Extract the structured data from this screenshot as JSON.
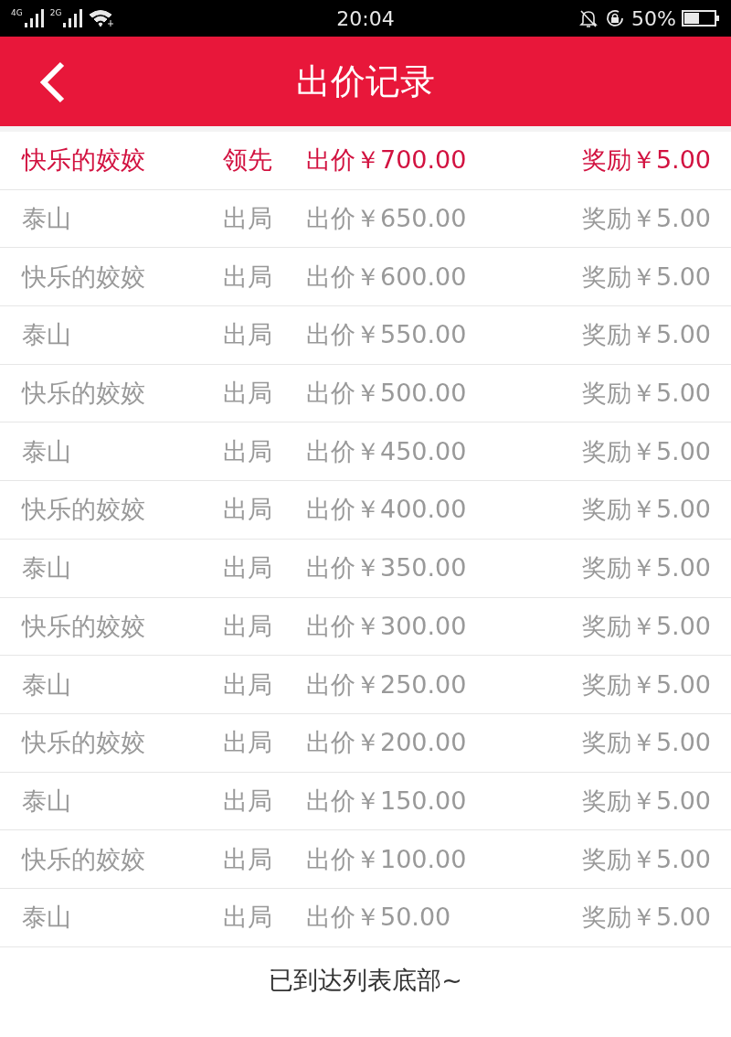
{
  "status_bar": {
    "networks": [
      "4G",
      "2G"
    ],
    "time": "20:04",
    "battery": "50%"
  },
  "header": {
    "title": "出价记录"
  },
  "rows": [
    {
      "name": "快乐的姣姣",
      "status": "领先",
      "bid": "出价￥700.00",
      "reward": "奖励￥5.00",
      "leading": true
    },
    {
      "name": "泰山",
      "status": "出局",
      "bid": "出价￥650.00",
      "reward": "奖励￥5.00",
      "leading": false
    },
    {
      "name": "快乐的姣姣",
      "status": "出局",
      "bid": "出价￥600.00",
      "reward": "奖励￥5.00",
      "leading": false
    },
    {
      "name": "泰山",
      "status": "出局",
      "bid": "出价￥550.00",
      "reward": "奖励￥5.00",
      "leading": false
    },
    {
      "name": "快乐的姣姣",
      "status": "出局",
      "bid": "出价￥500.00",
      "reward": "奖励￥5.00",
      "leading": false
    },
    {
      "name": "泰山",
      "status": "出局",
      "bid": "出价￥450.00",
      "reward": "奖励￥5.00",
      "leading": false
    },
    {
      "name": "快乐的姣姣",
      "status": "出局",
      "bid": "出价￥400.00",
      "reward": "奖励￥5.00",
      "leading": false
    },
    {
      "name": "泰山",
      "status": "出局",
      "bid": "出价￥350.00",
      "reward": "奖励￥5.00",
      "leading": false
    },
    {
      "name": "快乐的姣姣",
      "status": "出局",
      "bid": "出价￥300.00",
      "reward": "奖励￥5.00",
      "leading": false
    },
    {
      "name": "泰山",
      "status": "出局",
      "bid": "出价￥250.00",
      "reward": "奖励￥5.00",
      "leading": false
    },
    {
      "name": "快乐的姣姣",
      "status": "出局",
      "bid": "出价￥200.00",
      "reward": "奖励￥5.00",
      "leading": false
    },
    {
      "name": "泰山",
      "status": "出局",
      "bid": "出价￥150.00",
      "reward": "奖励￥5.00",
      "leading": false
    },
    {
      "name": "快乐的姣姣",
      "status": "出局",
      "bid": "出价￥100.00",
      "reward": "奖励￥5.00",
      "leading": false
    },
    {
      "name": "泰山",
      "status": "出局",
      "bid": "出价￥50.00",
      "reward": "奖励￥5.00",
      "leading": false
    }
  ],
  "footer": "已到达列表底部~"
}
